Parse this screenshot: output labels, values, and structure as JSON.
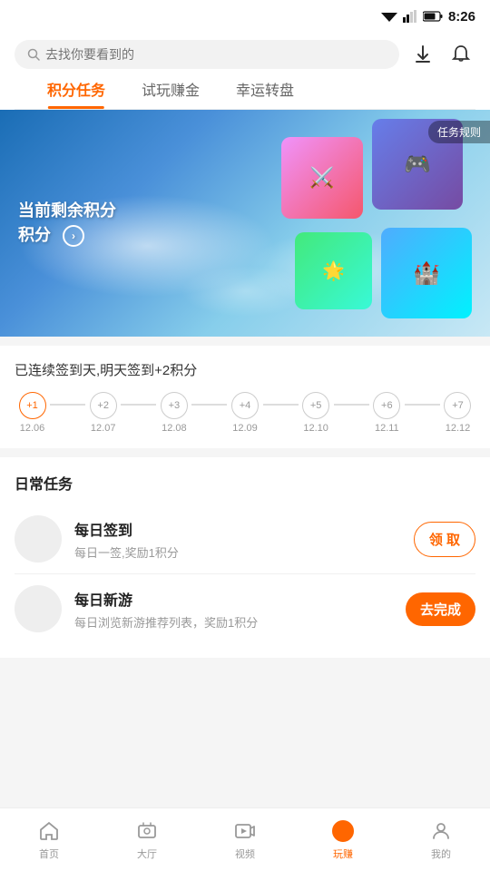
{
  "statusBar": {
    "time": "8:26"
  },
  "header": {
    "searchPlaceholder": "去找你要看到的",
    "downloadIcon": "download-icon",
    "notificationIcon": "notification-icon"
  },
  "tabs": [
    {
      "id": "points",
      "label": "积分任务",
      "active": true
    },
    {
      "id": "trial",
      "label": "试玩赚金",
      "active": false
    },
    {
      "id": "lucky",
      "label": "幸运转盘",
      "active": false
    }
  ],
  "banner": {
    "mainText": "当前剩余积分\n积分",
    "ruleLabel": "任务规则"
  },
  "checkin": {
    "description": "已连续签到天,明天签到+2积分",
    "days": [
      {
        "bonus": "+1",
        "date": "12.06"
      },
      {
        "bonus": "+2",
        "date": "12.07"
      },
      {
        "bonus": "+3",
        "date": "12.08"
      },
      {
        "bonus": "+4",
        "date": "12.09"
      },
      {
        "bonus": "+5",
        "date": "12.10"
      },
      {
        "bonus": "+6",
        "date": "12.11"
      },
      {
        "bonus": "+7",
        "date": "12.12"
      }
    ]
  },
  "dailyTasks": {
    "sectionTitle": "日常任务",
    "tasks": [
      {
        "id": "daily-checkin",
        "name": "每日签到",
        "desc": "每日一签,奖励1积分",
        "btnLabel": "领 取",
        "btnType": "claim"
      },
      {
        "id": "daily-newgame",
        "name": "每日新游",
        "desc": "每日浏览新游推荐列表，奖励1积分",
        "btnLabel": "去完成",
        "btnType": "go"
      }
    ]
  },
  "bottomNav": [
    {
      "id": "home",
      "label": "首页",
      "icon": "home-icon",
      "active": false
    },
    {
      "id": "hall",
      "label": "大厅",
      "icon": "hall-icon",
      "active": false
    },
    {
      "id": "video",
      "label": "视频",
      "icon": "video-icon",
      "active": false
    },
    {
      "id": "earn",
      "label": "玩赚",
      "icon": "earn-icon",
      "active": true
    },
    {
      "id": "mine",
      "label": "我的",
      "icon": "mine-icon",
      "active": false
    }
  ]
}
